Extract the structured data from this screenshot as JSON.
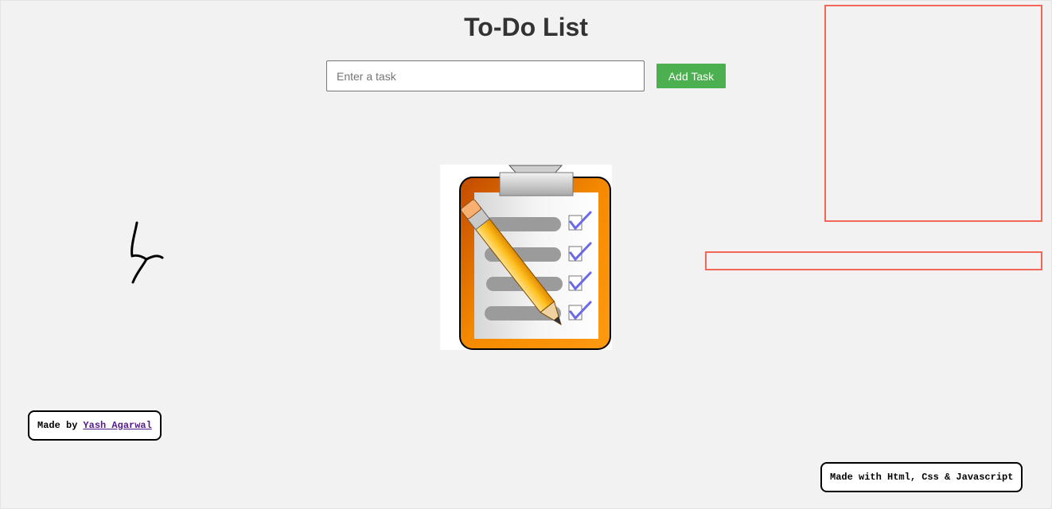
{
  "header": {
    "title": "To-Do List"
  },
  "task_form": {
    "input_value": "",
    "input_placeholder": "Enter a task",
    "add_button_label": "Add Task"
  },
  "illustration": {
    "icon": "clipboard-checklist-pencil-icon"
  },
  "footer": {
    "made_by_prefix": "Made by",
    "author_name": "Yash Agarwal",
    "tech_note": "Made with Html, Css & Javascript"
  },
  "colors": {
    "background": "#f2f2f2",
    "title_text": "#333333",
    "add_button": "#4caf50",
    "overlay_outline": "#f26755",
    "author_link": "#551a8b"
  }
}
